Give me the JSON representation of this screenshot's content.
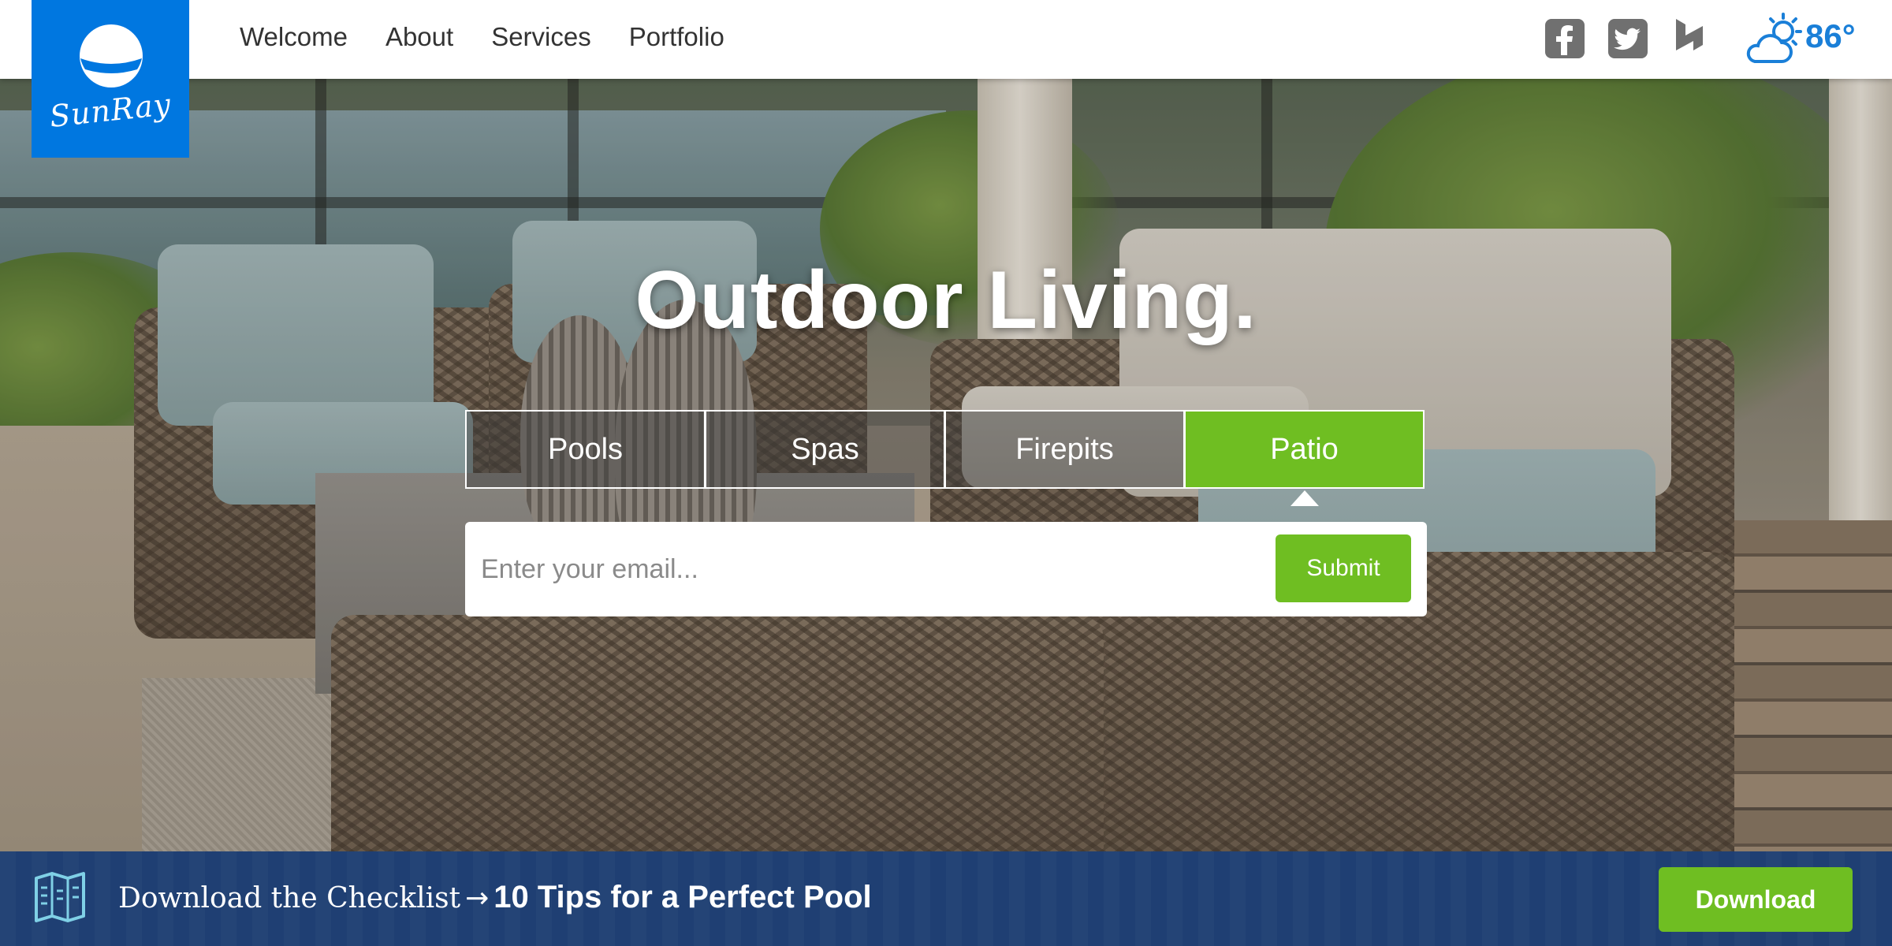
{
  "brand": {
    "logo_text": "SunRay",
    "logo_color": "#0077e0"
  },
  "nav": {
    "items": [
      {
        "label": "Welcome"
      },
      {
        "label": "About"
      },
      {
        "label": "Services"
      },
      {
        "label": "Portfolio"
      }
    ]
  },
  "social": {
    "icons": [
      "facebook-icon",
      "twitter-icon",
      "houzz-icon"
    ],
    "icon_color": "#707070"
  },
  "weather": {
    "icon": "partly-cloudy-icon",
    "temperature": "86°",
    "color": "#1a7fd8"
  },
  "hero": {
    "headline": "Outdoor Living.",
    "tabs": [
      {
        "label": "Pools",
        "active": false
      },
      {
        "label": "Spas",
        "active": false
      },
      {
        "label": "Firepits",
        "active": false
      },
      {
        "label": "Patio",
        "active": true
      }
    ],
    "accent_color": "#6fbe22",
    "email_placeholder": "Enter your email...",
    "email_value": "",
    "submit_label": "Submit"
  },
  "cta_bar": {
    "icon": "checklist-map-icon",
    "lead": "Download the Checklist",
    "arrow": "→",
    "title": "10 Tips for a Perfect Pool",
    "button_label": "Download",
    "background_color": "#1f3f73"
  }
}
